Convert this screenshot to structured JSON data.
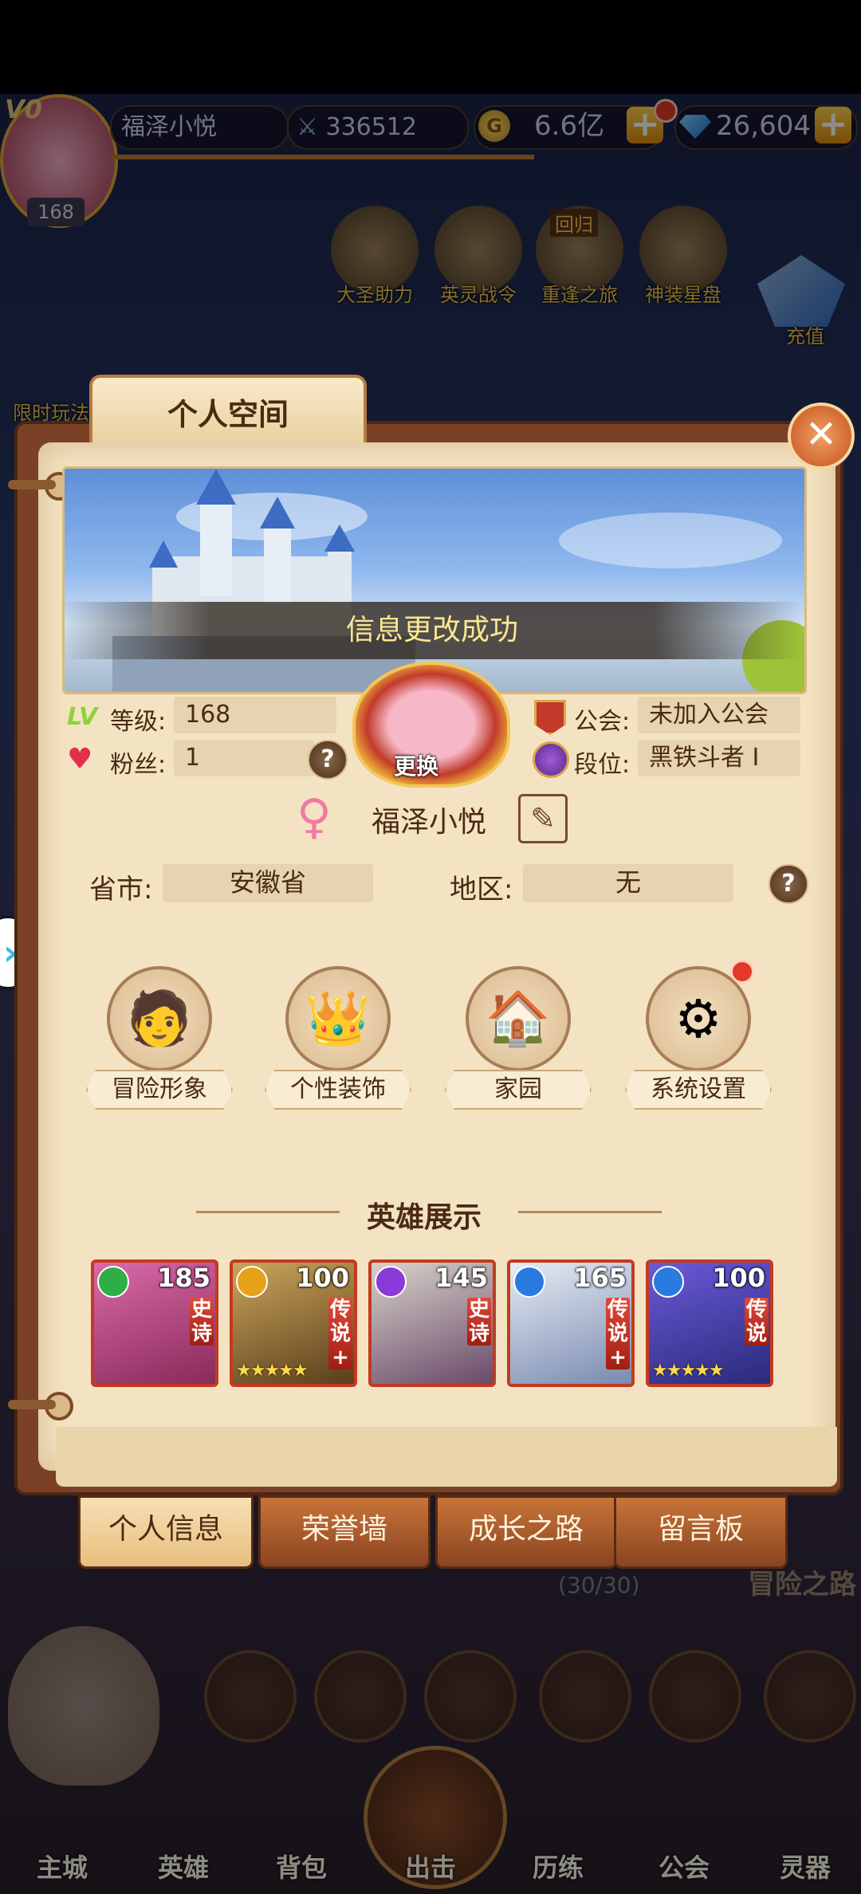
{
  "top_bar": {
    "vip_label": "V0",
    "player_level": "168",
    "player_name": "福泽小悦",
    "power": "336512",
    "gold": "6.6亿",
    "gold_icon_glyph": "G",
    "diamonds": "26,604",
    "plus_glyph": "+"
  },
  "top_icons": [
    "大圣助力",
    "英灵战令",
    "重逢之旅",
    "神装星盘"
  ],
  "top_icon_badge": "回归",
  "side_labels": {
    "recharge": "充值",
    "limited": "限时玩法",
    "adventure_road": "冒险之路"
  },
  "panel": {
    "title": "个人空间",
    "close_glyph": "✕",
    "toast": "信息更改成功",
    "avatar_change_label": "更换",
    "level_label": "等级:",
    "level_value": "168",
    "fans_label": "粉丝:",
    "fans_value": "1",
    "guild_label": "公会:",
    "guild_value": "未加入公会",
    "rank_label": "段位:",
    "rank_value": "黑铁斗者 I",
    "lv_icon_text": "LV",
    "gender_icon_glyph": "♀",
    "name": "福泽小悦",
    "province_label": "省市:",
    "province_value": "安徽省",
    "region_label": "地区:",
    "region_value": "无",
    "help_glyph": "?",
    "actions": [
      {
        "label": "冒险形象"
      },
      {
        "label": "个性装饰"
      },
      {
        "label": "家园"
      },
      {
        "label": "系统设置"
      }
    ],
    "heroes_title": "英雄展示",
    "heroes": [
      {
        "level": "185",
        "rarity": "史诗",
        "element_color": "#2fae45"
      },
      {
        "level": "100",
        "rarity": "传说+",
        "element_color": "#e8a21a"
      },
      {
        "level": "145",
        "rarity": "史诗",
        "element_color": "#8a3ad8"
      },
      {
        "level": "165",
        "rarity": "传说+",
        "element_color": "#2a7ae0"
      },
      {
        "level": "100",
        "rarity": "传说",
        "element_color": "#2a7ae0"
      }
    ],
    "star_glyphs": "★★★★★",
    "tabs": [
      "个人信息",
      "荣誉墙",
      "成长之路",
      "留言板"
    ]
  },
  "behind_panel": {
    "progress_text": "(30/30)"
  },
  "bottom_nav": [
    "主城",
    "英雄",
    "背包",
    "出击",
    "历练",
    "公会",
    "灵器"
  ],
  "colors": {
    "accent": "#c2511e",
    "paper": "#f4e3c2",
    "panel_frame": "#7a4126",
    "toast_text": "#fde890"
  }
}
